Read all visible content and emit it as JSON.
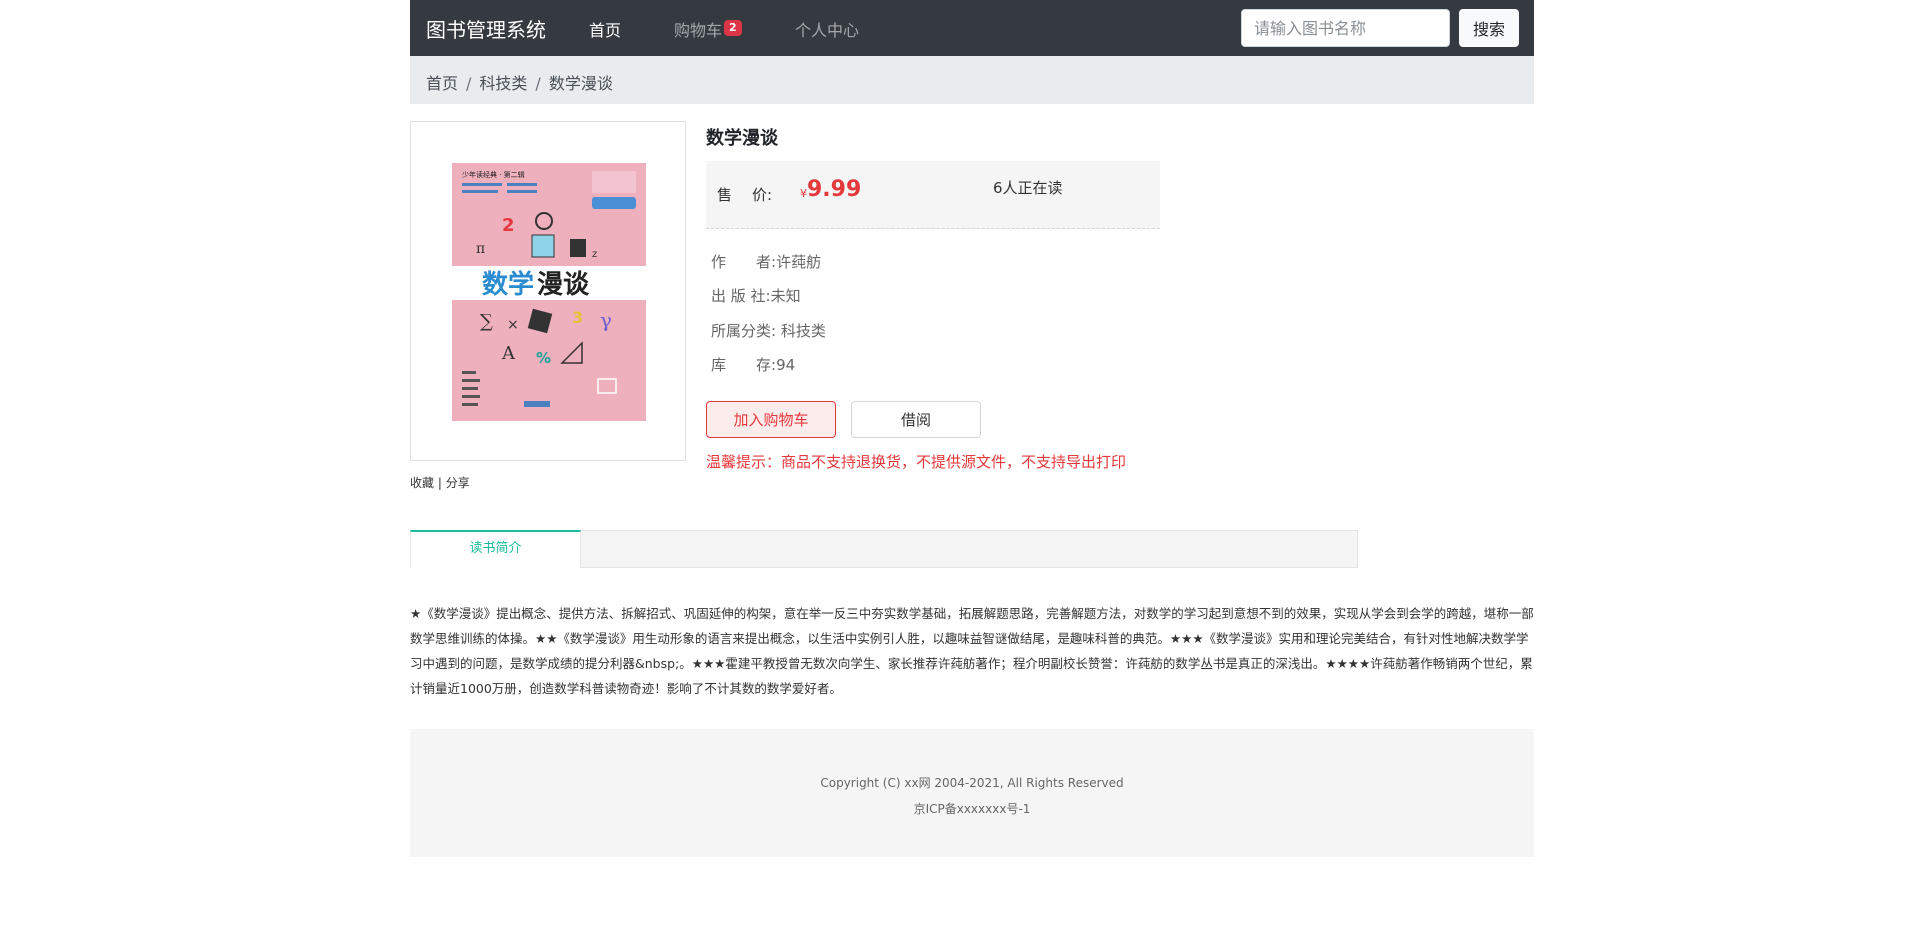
{
  "navbar": {
    "brand": "图书管理系统",
    "home": "首页",
    "cart": "购物车",
    "cart_count": "2",
    "profile": "个人中心",
    "search_placeholder": "请输入图书名称",
    "search_button": "搜索"
  },
  "breadcrumb": {
    "items": [
      "首页",
      "科技类",
      "数学漫谈"
    ]
  },
  "cover": {
    "series": "少年读经典 · 第二辑",
    "title_part1": "数学",
    "title_part2": "漫谈"
  },
  "links": {
    "favorite": "收藏",
    "separator": "|",
    "share": "分享"
  },
  "book": {
    "title": "数学漫谈",
    "price_label_1": "售",
    "price_label_2": "价:",
    "currency": "¥",
    "price": "9.99",
    "readers": "6人正在读",
    "author_label": "作　　者:",
    "author": "许莼舫",
    "publisher_label": "出  版  社:",
    "publisher": "未知",
    "category_label": "所属分类:",
    "category": "科技类",
    "stock_label": "库　　存:",
    "stock": "94"
  },
  "actions": {
    "add_to_cart": "加入购物车",
    "borrow": "借阅",
    "tip": "温馨提示：商品不支持退换货，不提供源文件，不支持导出打印"
  },
  "tabs": {
    "intro": "读书简介"
  },
  "summary": "★《数学漫谈》提出概念、提供方法、拆解招式、巩固延伸的构架，意在举一反三中夯实数学基础，拓展解题思路，完善解题方法，对数学的学习起到意想不到的效果，实现从学会到会学的跨越，堪称一部数学思维训练的体操。★★《数学漫谈》用生动形象的语言来提出概念，以生活中实例引人胜，以趣味益智谜做结尾，是趣味科普的典范。★★★《数学漫谈》实用和理论完美结合，有针对性地解决数学学习中遇到的问题，是数学成绩的提分利器&nbsp;。★★★霍建平教授曾无数次向学生、家长推荐许莼舫著作；程介明副校长赞誉：许莼舫的数学丛书是真正的深浅出。★★★★许莼舫著作畅销两个世纪，累计销量近1000万册，创造数学科普读物奇迹！影响了不计其数的数学爱好者。",
  "footer": {
    "copyright": "Copyright (C) xx网 2004-2021, All Rights Reserved",
    "icp": "京ICP备xxxxxxx号-1"
  },
  "colors": {
    "navbar": "#343a40",
    "accent_red": "#e4393c",
    "tab_green": "#1abc9c",
    "cover_pink": "#eeb0bd"
  }
}
